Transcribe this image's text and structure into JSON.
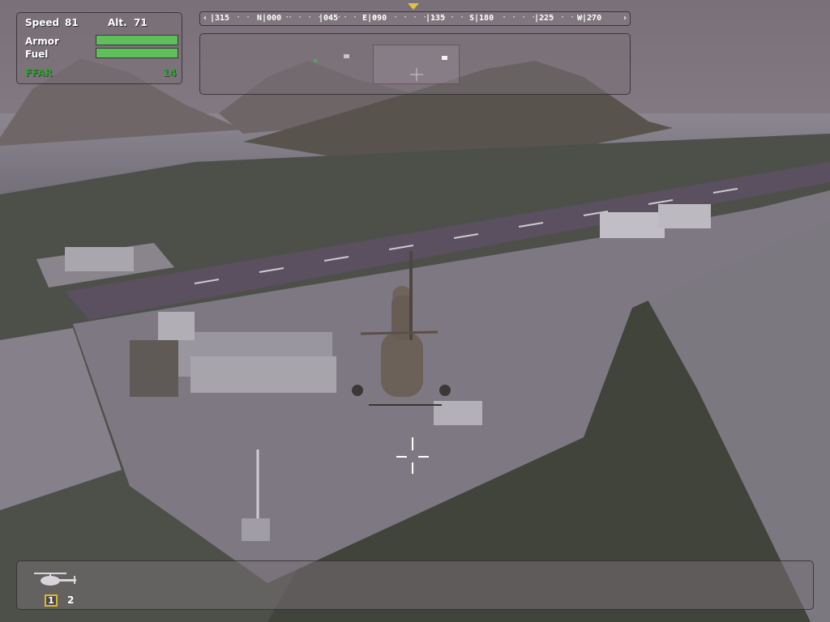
{
  "hud": {
    "speed_label": "Speed",
    "speed_value": "81",
    "alt_label": "Alt.",
    "alt_value": "71",
    "armor_label": "Armor",
    "armor_level": 1.0,
    "fuel_label": "Fuel",
    "fuel_level": 1.0,
    "weapon_name": "FFAR",
    "weapon_ammo": "14"
  },
  "compass": {
    "headings": [
      "|315",
      "N|000",
      "|045",
      "E|090",
      "|135",
      "S|180",
      "|225",
      "W|270"
    ],
    "left_cap": "‹",
    "right_cap": "›"
  },
  "vehicle_slots": {
    "active": "1",
    "other": "2"
  },
  "colors": {
    "health_bar": "#5fbf5a",
    "weapon_text": "#2fa32f",
    "compass_marker": "#e2c33a",
    "slot_highlight": "#d9b82c"
  },
  "icons": {
    "vehicle": "helicopter-icon",
    "crosshair": "crosshair-icon",
    "heading_marker": "heading-marker-icon"
  }
}
